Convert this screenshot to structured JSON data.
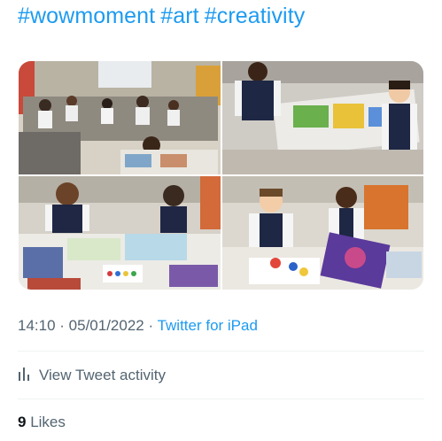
{
  "tweet": {
    "hashtags": [
      "#wowmoment",
      "#art",
      "#creativity"
    ]
  },
  "media": {
    "photos": [
      {
        "alt": "classroom-hands-raised"
      },
      {
        "alt": "boys-painting-at-table"
      },
      {
        "alt": "girls-painting"
      },
      {
        "alt": "boys-with-paintings"
      }
    ]
  },
  "meta": {
    "time": "14:10",
    "separator": " · ",
    "date": "05/01/2022",
    "separator2": " · ",
    "source": "Twitter for iPad"
  },
  "activity": {
    "label": "View Tweet activity",
    "icon": "bar-chart-icon"
  },
  "likes": {
    "count": "9",
    "label": " Likes"
  },
  "colors": {
    "link": "#1d9bf0",
    "secondary": "#536471",
    "divider": "#eff3f4"
  }
}
